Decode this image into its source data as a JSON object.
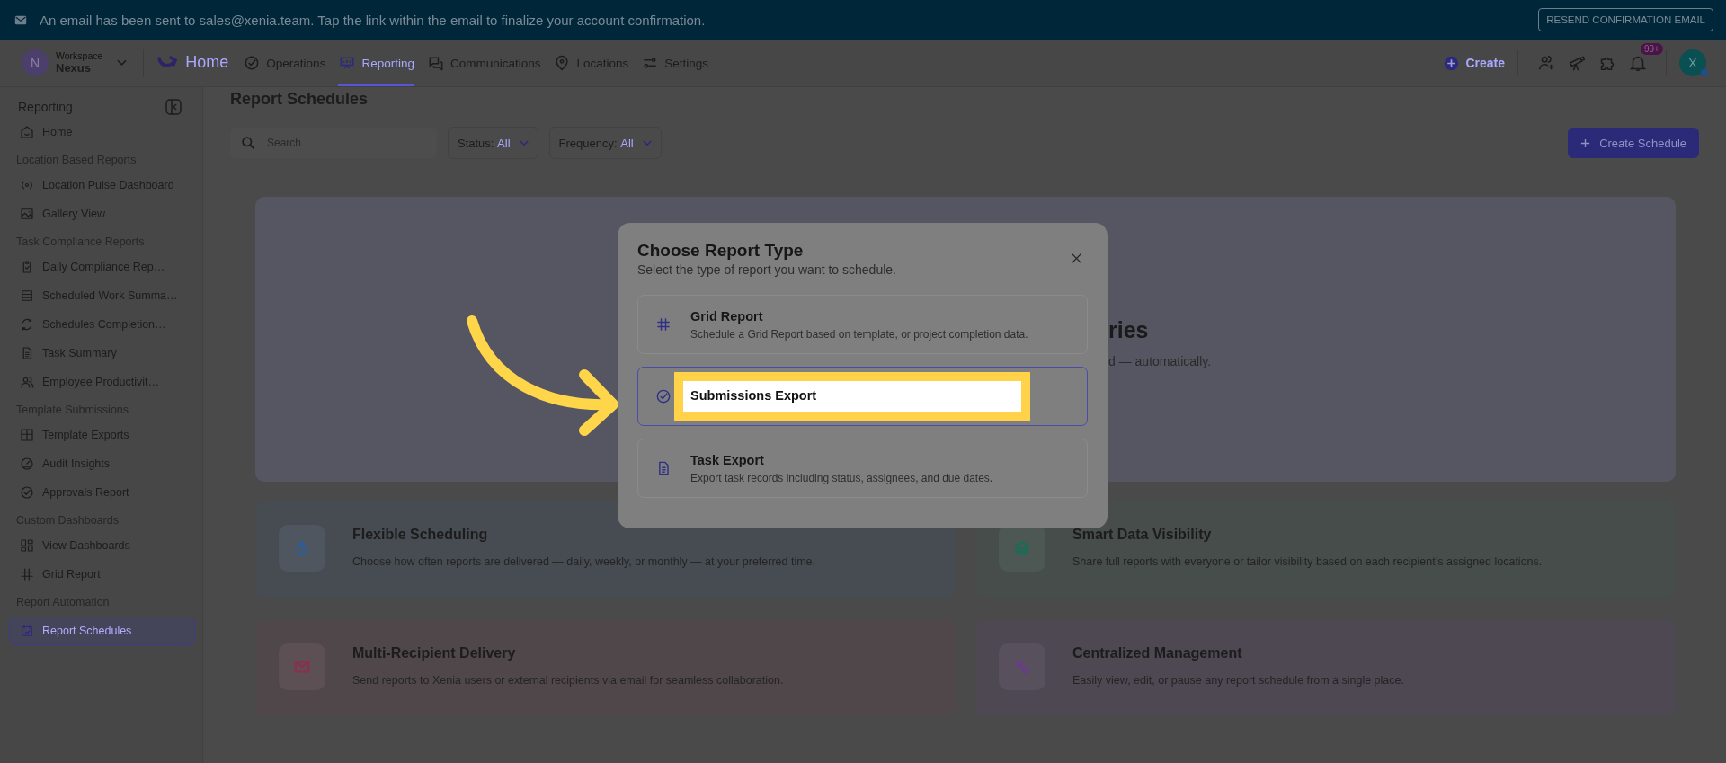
{
  "banner": {
    "message": "An email has been sent to sales@xenia.team. Tap the link within the email to finalize your account confirmation.",
    "button": "RESEND CONFIRMATION EMAIL"
  },
  "workspace": {
    "initial": "N",
    "label": "Workspace",
    "name": "Nexus"
  },
  "nav": [
    {
      "label": "Home",
      "kind": "brand",
      "selected": false
    },
    {
      "label": "Operations",
      "kind": "link",
      "selected": false
    },
    {
      "label": "Reporting",
      "kind": "link",
      "selected": true
    },
    {
      "label": "Communications",
      "kind": "link",
      "selected": false
    },
    {
      "label": "Locations",
      "kind": "link",
      "selected": false
    },
    {
      "label": "Settings",
      "kind": "link",
      "selected": false
    }
  ],
  "header_actions": {
    "create": "Create",
    "notifications_badge": "99+",
    "avatar_initial": "X"
  },
  "sidebar": {
    "title": "Reporting",
    "sections": [
      {
        "items": [
          {
            "label": "Home",
            "selected": false
          }
        ]
      },
      {
        "heading": "Location Based Reports",
        "items": [
          {
            "label": "Location Pulse Dashboard",
            "selected": false
          },
          {
            "label": "Gallery View",
            "selected": false
          }
        ]
      },
      {
        "heading": "Task Compliance Reports",
        "items": [
          {
            "label": "Daily Compliance Rep…",
            "selected": false
          },
          {
            "label": "Scheduled Work Summa…",
            "selected": false
          },
          {
            "label": "Schedules Completion…",
            "selected": false
          },
          {
            "label": "Task Summary",
            "selected": false
          },
          {
            "label": "Employee Productivit…",
            "selected": false
          }
        ]
      },
      {
        "heading": "Template Submissions",
        "items": [
          {
            "label": "Template Exports",
            "selected": false
          },
          {
            "label": "Audit Insights",
            "selected": false
          },
          {
            "label": "Approvals Report",
            "selected": false
          }
        ]
      },
      {
        "heading": "Custom Dashboards",
        "items": [
          {
            "label": "View Dashboards",
            "selected": false
          },
          {
            "label": "Grid Report",
            "selected": false
          }
        ]
      },
      {
        "heading": "Report Automation",
        "items": [
          {
            "label": "Report Schedules",
            "selected": true
          }
        ]
      }
    ]
  },
  "page": {
    "title": "Report Schedules",
    "search": {
      "placeholder": "Search"
    },
    "filters": [
      {
        "label": "Status:",
        "value": "All"
      },
      {
        "label": "Frequency:",
        "value": "All"
      }
    ],
    "create_button": "Create Schedule",
    "hero": {
      "title_fragment": "ries",
      "subtitle_fragment": "d — automatically."
    },
    "features": [
      {
        "title": "Flexible Scheduling",
        "description": "Choose how often reports are delivered — daily, weekly, or monthly — at your preferred time.",
        "color": "#2a5f9e"
      },
      {
        "title": "Smart Data Visibility",
        "description": "Share full reports with everyone or tailor visibility based on each recipient’s assigned locations.",
        "color": "#1d6b55"
      },
      {
        "title": "Multi-Recipient Delivery",
        "description": "Send reports to Xenia users or external recipients via email for seamless collaboration.",
        "color": "#8a2f4c"
      },
      {
        "title": "Centralized Management",
        "description": "Easily view, edit, or pause any report schedule from a single place.",
        "color": "#6b3a8f"
      }
    ]
  },
  "modal": {
    "title": "Choose Report Type",
    "subtitle": "Select the type of report you want to schedule.",
    "options": [
      {
        "title": "Grid Report",
        "description": "Schedule a Grid Report based on template, or project completion data.",
        "selected": false,
        "highlighted": false
      },
      {
        "title": "Submissions Export",
        "selected": true,
        "highlighted": true
      },
      {
        "title": "Task Export",
        "description": "Export task records including status, assignees, and due dates.",
        "selected": false,
        "highlighted": false
      }
    ]
  }
}
